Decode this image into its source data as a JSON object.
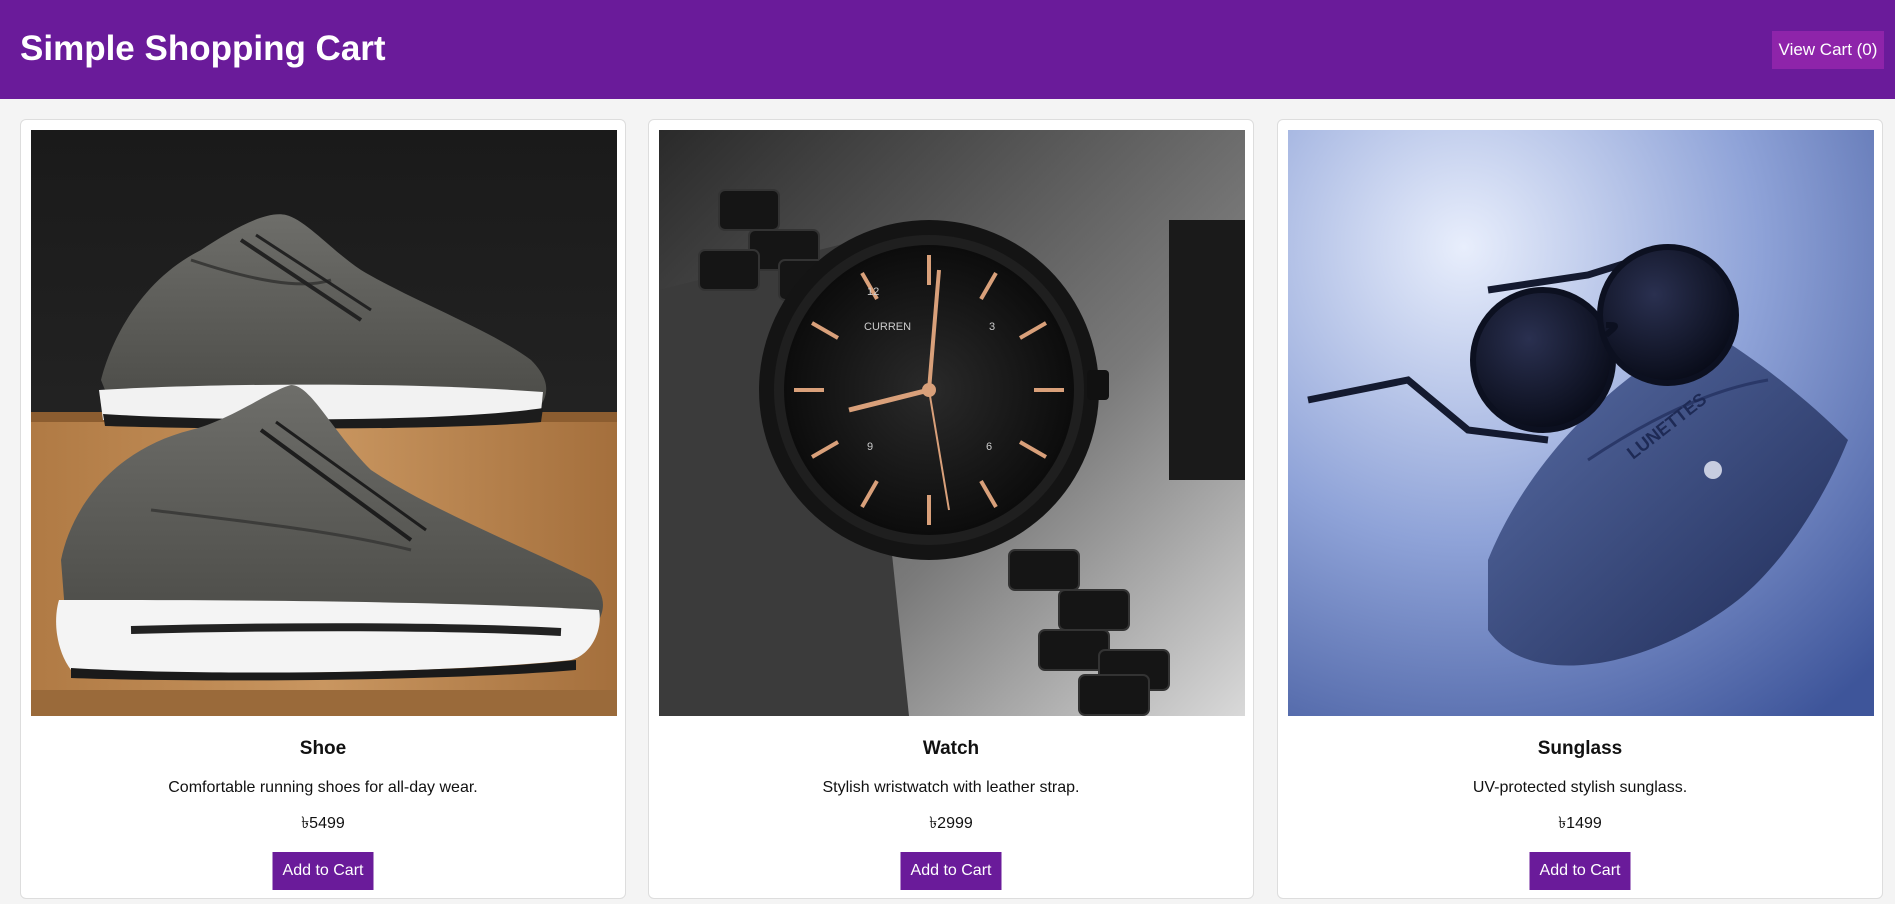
{
  "header": {
    "title": "Simple Shopping Cart",
    "view_cart_label": "View Cart (0)",
    "background_color": "#6a1b9a",
    "button_color": "#8e24aa"
  },
  "products": [
    {
      "name": "Shoe",
      "description": "Comfortable running shoes for all-day wear.",
      "price": "৳5499",
      "button_label": "Add to Cart",
      "image": "sneakers-photo"
    },
    {
      "name": "Watch",
      "description": "Stylish wristwatch with leather strap.",
      "price": "৳2999",
      "button_label": "Add to Cart",
      "image": "black-wristwatch-photo",
      "image_text": {
        "brand": "CURREN",
        "dial_12": "12",
        "dial_3": "3",
        "dial_6": "6",
        "dial_9": "9"
      }
    },
    {
      "name": "Sunglass",
      "description": "UV-protected stylish sunglass.",
      "price": "৳1499",
      "button_label": "Add to Cart",
      "image": "round-sunglasses-photo",
      "image_text": {
        "case_brand": "LUNETTES"
      }
    }
  ]
}
